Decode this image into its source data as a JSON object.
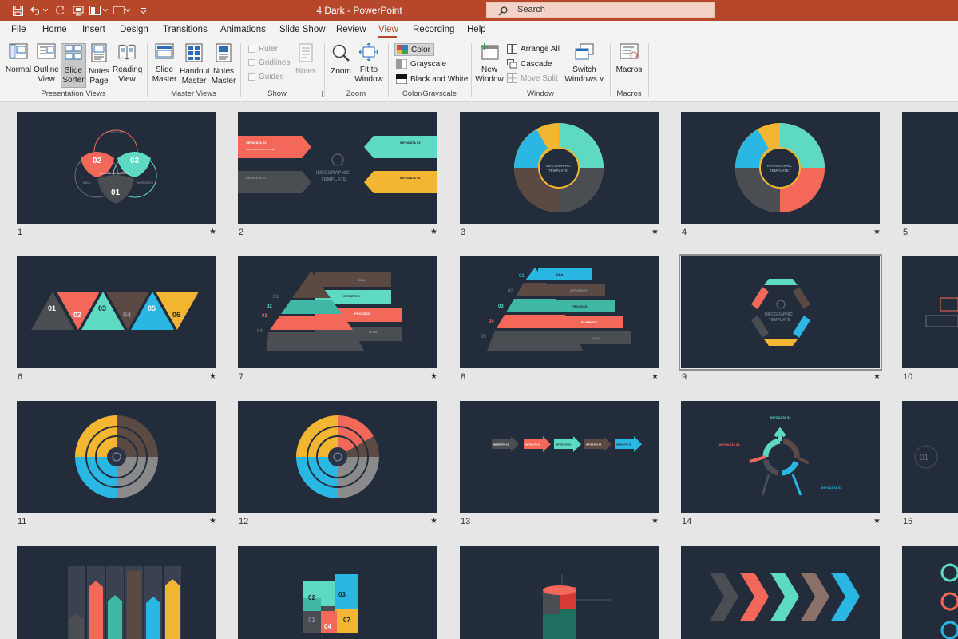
{
  "window": {
    "title": "4 Dark  -  PowerPoint",
    "search_placeholder": "Search"
  },
  "tabs": [
    "File",
    "Home",
    "Insert",
    "Design",
    "Transitions",
    "Animations",
    "Slide Show",
    "Review",
    "View",
    "Recording",
    "Help"
  ],
  "active_tab": "View",
  "ribbon": {
    "presentation_views": {
      "label": "Presentation Views",
      "normal": "Normal",
      "outline": [
        "Outline",
        "View"
      ],
      "slide_sorter": [
        "Slide",
        "Sorter"
      ],
      "notes_page": [
        "Notes",
        "Page"
      ],
      "reading_view": [
        "Reading",
        "View"
      ]
    },
    "master_views": {
      "label": "Master Views",
      "slide_master": [
        "Slide",
        "Master"
      ],
      "handout_master": [
        "Handout",
        "Master"
      ],
      "notes_master": [
        "Notes",
        "Master"
      ]
    },
    "show": {
      "label": "Show",
      "ruler": "Ruler",
      "gridlines": "Gridlines",
      "guides": "Guides",
      "notes": "Notes"
    },
    "zoom": {
      "label": "Zoom",
      "zoom": "Zoom",
      "fit_to_window": [
        "Fit to",
        "Window"
      ]
    },
    "color_grayscale": {
      "label": "Color/Grayscale",
      "color": "Color",
      "grayscale": "Grayscale",
      "black_and_white": "Black and White"
    },
    "window": {
      "label": "Window",
      "new_window": [
        "New",
        "Window"
      ],
      "arrange_all": "Arrange All",
      "cascade": "Cascade",
      "move_split": "Move Split",
      "switch_windows": [
        "Switch",
        "Windows ˅"
      ]
    },
    "macros": {
      "label": "Macros",
      "macros": "Macros"
    }
  },
  "slides": [
    {
      "num": "1",
      "star": "★"
    },
    {
      "num": "2",
      "star": "★"
    },
    {
      "num": "3",
      "star": "★"
    },
    {
      "num": "4",
      "star": "★"
    },
    {
      "num": "5",
      "star": ""
    },
    {
      "num": "6",
      "star": "★"
    },
    {
      "num": "7",
      "star": "★"
    },
    {
      "num": "8",
      "star": "★"
    },
    {
      "num": "9",
      "star": "★"
    },
    {
      "num": "10",
      "star": ""
    },
    {
      "num": "11",
      "star": "★"
    },
    {
      "num": "12",
      "star": "★"
    },
    {
      "num": "13",
      "star": "★"
    },
    {
      "num": "14",
      "star": "★"
    },
    {
      "num": "15",
      "star": ""
    },
    {
      "num": "",
      "star": ""
    },
    {
      "num": "",
      "star": ""
    },
    {
      "num": "",
      "star": ""
    },
    {
      "num": "",
      "star": ""
    },
    {
      "num": "",
      "star": ""
    }
  ],
  "slide_text": {
    "s1": {
      "n1": "01",
      "n2": "02",
      "n3": "03",
      "idea": "IDEA",
      "business": "BUSINESS",
      "strategy": "STRATEGY",
      "center": "INFOGRAPHIC TEMPLATE"
    },
    "s2": {
      "title1": "INFOGRAPHIC",
      "title2": "TEMPLATE",
      "i1": "INFODATA 01",
      "i2": "INFODATA 02",
      "i3": "INFODATA 03",
      "i4": "INFODATA 04",
      "body": "Lorem ipsum dolor sit amet"
    },
    "s3": {
      "center1": "INFOGRAPHIC",
      "center2": "TEMPLATE"
    },
    "s4": {
      "center1": "INFOGRAPHIC",
      "center2": "TEMPLATE"
    },
    "s6": {
      "n1": "01",
      "n2": "02",
      "n3": "03",
      "n4": "04",
      "n5": "05",
      "n6": "06"
    },
    "s7": {
      "n1": "01",
      "n2": "02",
      "n3": "03",
      "n4": "04",
      "idea": "IDEA",
      "strategy": "STRATEGY",
      "process": "PROCESS",
      "goal": "GOAL"
    },
    "s8": {
      "n1": "01",
      "n2": "02",
      "n3": "03",
      "n4": "04",
      "n5": "05",
      "idea": "IDEA",
      "strategy": "STRATEGY",
      "process": "PROCESS",
      "business": "BUSINESS",
      "goal": "GOAL"
    },
    "s9": {
      "center1": "INFOGRAPHIC",
      "center2": "TEMPLATE"
    },
    "s13": {
      "i1": "INFODATA 01",
      "i2": "INFODATA 02",
      "i3": "INFODATA 03",
      "i4": "INFODATA 04",
      "i5": "INFODATA 05"
    },
    "s14": {
      "i1": "INFODATA 01",
      "i2": "INFODATA 02",
      "i3": "INFODATA 03"
    },
    "s15": {
      "n1": "01"
    },
    "s17": {
      "n1": "01",
      "n2": "02",
      "n3": "03",
      "n4": "04",
      "n5": "07"
    }
  },
  "colors": {
    "accent": "#b7472a",
    "slide_bg": "#232c3b",
    "teal": "#5ed9c2",
    "coral": "#f4685a",
    "yellow": "#f2b632",
    "cyan": "#2ab7e3",
    "brown": "#5b4a44",
    "gray": "#4a4e52"
  }
}
